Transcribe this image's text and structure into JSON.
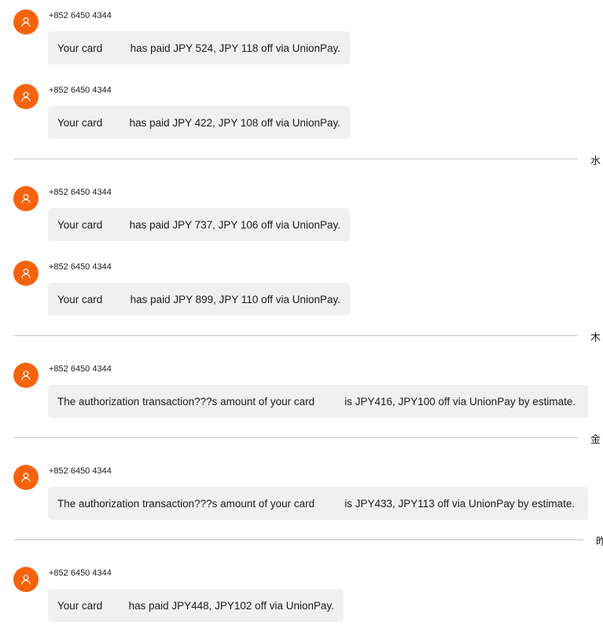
{
  "messages": [
    {
      "sender": "+852 6450 4344",
      "pre": "Your card",
      "post": "has paid JPY 524, JPY 118 off via UnionPay."
    },
    {
      "sender": "+852 6450 4344",
      "pre": "Your card",
      "post": "has paid JPY 422, JPY 108 off via UnionPay."
    },
    {
      "sender": "+852 6450 4344",
      "pre": "Your card",
      "post": "has paid JPY 737, JPY 106 off via UnionPay."
    },
    {
      "sender": "+852 6450 4344",
      "pre": "Your card",
      "post": "has paid JPY 899, JPY 110 off via UnionPay."
    },
    {
      "sender": "+852 6450 4344",
      "pre": "The authorization transaction???s amount of your card",
      "post": "is JPY416, JPY100 off via UnionPay by estimate."
    },
    {
      "sender": "+852 6450 4344",
      "pre": "The authorization transaction???s amount of your card",
      "post": "is JPY433, JPY113 off via UnionPay by estimate."
    },
    {
      "sender": "+852 6450 4344",
      "pre": "Your card",
      "post": "has paid JPY448, JPY102 off via UnionPay."
    }
  ],
  "dividers": [
    {
      "label": "水"
    },
    {
      "label": "木"
    },
    {
      "label": "金"
    },
    {
      "label": "昨"
    }
  ],
  "colors": {
    "avatar": "#f7630c",
    "bubble": "#f0f0f0",
    "divider": "#c8c8c8"
  },
  "icons": {
    "avatar": "person-icon"
  }
}
